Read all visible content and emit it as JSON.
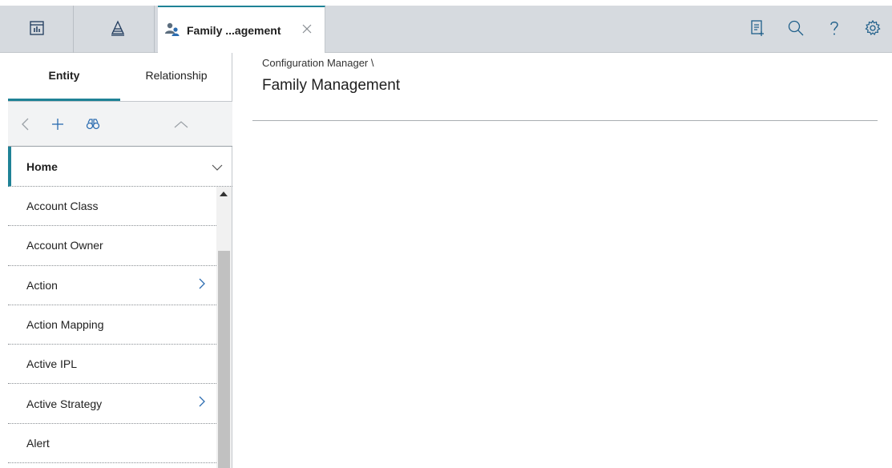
{
  "topbar": {
    "active_tab_label": "Family ...agement",
    "icons": [
      "dashboard-icon",
      "pyramid-icon",
      "family-users-icon",
      "close-icon",
      "report-icon",
      "search-icon",
      "help-icon",
      "settings-icon"
    ]
  },
  "panel": {
    "tabs": [
      {
        "label": "Entity",
        "active": true
      },
      {
        "label": "Relationship",
        "active": false
      }
    ],
    "home_label": "Home",
    "items": [
      {
        "label": "Account Class",
        "has_children": false
      },
      {
        "label": "Account Owner",
        "has_children": false
      },
      {
        "label": "Action",
        "has_children": true
      },
      {
        "label": "Action Mapping",
        "has_children": false
      },
      {
        "label": "Active IPL",
        "has_children": false
      },
      {
        "label": "Active Strategy",
        "has_children": true
      },
      {
        "label": "Alert",
        "has_children": false
      }
    ]
  },
  "main": {
    "breadcrumb": "Configuration Manager \\",
    "title": "Family Management"
  },
  "colors": {
    "accent": "#1f8296",
    "topbar_bg": "#d6dadf",
    "icon_blue": "#2b6cb0"
  }
}
